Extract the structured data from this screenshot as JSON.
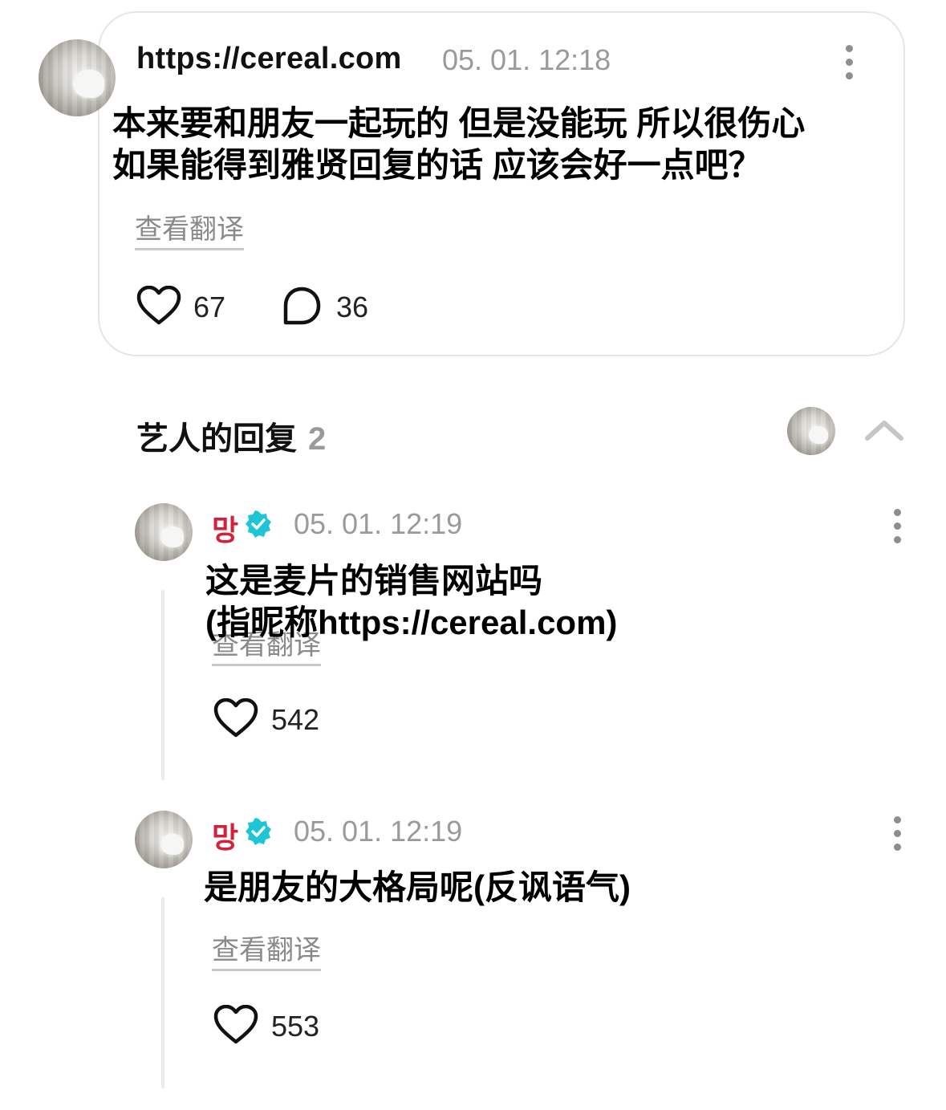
{
  "post": {
    "author": "https://cereal.com",
    "timestamp": "05. 01. 12:18",
    "text_line1": "本来要和朋友一起玩的 但是没能玩 所以很伤心",
    "text_line2": "如果能得到雅贤回复的话 应该会好一点吧？",
    "translate_label": "查看翻译",
    "likes": "67",
    "comments": "36"
  },
  "replies_section": {
    "title": "艺人的回复",
    "count": "2"
  },
  "replies": [
    {
      "author": "망",
      "timestamp": "05. 01. 12:19",
      "text_line1": "这是麦片的销售网站吗",
      "text_line2": "(指昵称https://cereal.com)",
      "translate_label": "查看翻译",
      "likes": "542"
    },
    {
      "author": "망",
      "timestamp": "05. 01. 12:19",
      "text_line1": "是朋友的大格局呢(反讽语气)",
      "translate_label": "查看翻译",
      "likes": "553"
    }
  ],
  "colors": {
    "artist_name": "#d4203a",
    "verified_badge": "#1cc6d6",
    "muted_text": "#9a9a9a",
    "card_border": "#e6e6e6"
  },
  "icons": [
    "heart-icon",
    "comment-bubble-icon",
    "more-options-icon",
    "verified-badge-icon",
    "chevron-up-icon"
  ]
}
